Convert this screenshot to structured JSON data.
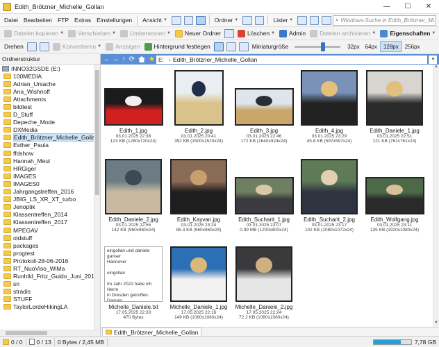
{
  "window": {
    "title": "Edith_Brötzner_Michelle_Gollan"
  },
  "menu": {
    "items": [
      "Datei",
      "Bearbeiten",
      "FTP",
      "Extras",
      "Einstellungen"
    ],
    "ansicht": "Ansicht",
    "ordner": "Ordner",
    "lister": "Lister",
    "search_placeholder": "Windows-Suche in Edith_Brötzner_Mi..."
  },
  "toolbar1": {
    "copy": "Dateien kopieren",
    "move": "Verschieben",
    "rename": "Umbenennen",
    "new_folder": "Neuer Ordner",
    "delete": "Löschen",
    "admin": "Admin",
    "archive": "Dateien archivieren",
    "properties": "Eigenschaften"
  },
  "toolbar2": {
    "rotate": "Drehen",
    "convert": "Konvertieren",
    "show": "Anzeigen",
    "set_background": "Hintergrund festlegen",
    "thumb_size_label": "Miniaturgröße",
    "sizes": [
      "32px",
      "64px",
      "128px",
      "256px"
    ],
    "active_size": "128px",
    "slider_fraction": 0.58
  },
  "tree": {
    "header": "Ordnerstruktur",
    "drive": "INNO32GSDE (E:)",
    "folders": [
      "100MEDIA",
      "Adrian_Ursache",
      "Ana_Wishnoff",
      "Attachments",
      "bildtest",
      "D_Stuff",
      "Depeche_Mode",
      "DXMedia",
      "Edith_Brötzner_Michelle_Gollan",
      "Esther_Paula",
      "ffdshow",
      "Hannah_Meul",
      "HRGiger",
      "IMAGES",
      "IMAGES0",
      "Jahrgangstreffen_2016",
      "JBIG_LS_XR_XT_turbo",
      "Jenoptik",
      "Klassentreffen_2014",
      "Klassentreffen_2017",
      "MPEGAV",
      "oldstuff",
      "packages",
      "progtest",
      "Protokoll-28-06-2016",
      "RT_NuoViso_WiMa",
      "Runhild_Fritz_Guido_Juni_2018",
      "sn",
      "stradis",
      "STUFF",
      "TaylorLordeHikingLA"
    ],
    "selected": "Edith_Brötzner_Michelle_Gollan"
  },
  "address": {
    "drive": "E:",
    "folder": "Edith_Brötzner_Michelle_Gollan"
  },
  "files": [
    {
      "name": "Edith_1.jpg",
      "date": "03.01.2025 22:38",
      "size": "123 KB (1280x720x24)",
      "shape": "land",
      "colors": [
        "#1b1b1b",
        "#d02020",
        "#f0f0f0"
      ]
    },
    {
      "name": "Edith_2.jpg",
      "date": "03.01.2025 20:41",
      "size": "352 KB (1500x1520x24)",
      "shape": "portrait",
      "colors": [
        "#e9eef2",
        "#d9c38a",
        "#1f2e4a"
      ]
    },
    {
      "name": "Edith_3.jpg",
      "date": "03.01.2025 22:46",
      "size": "172 KB (1640x924x24)",
      "shape": "land",
      "colors": [
        "#dfe5ec",
        "#caa66a",
        "#2a2e36"
      ]
    },
    {
      "name": "Edith_4.jpg",
      "date": "03.01.2025 23:29",
      "size": "45.8 KB (597x597x24)",
      "shape": "square",
      "colors": [
        "#7a92b8",
        "#222222",
        "#e4c07a"
      ]
    },
    {
      "name": "Edith_Daniele_1.jpg",
      "date": "03.01.2025 22:51",
      "size": "121 KB (761x761x24)",
      "shape": "square",
      "colors": [
        "#d8d5d0",
        "#2b2b2b",
        "#e0c07c"
      ]
    },
    {
      "name": "Edith_Daniele_2.jpg",
      "date": "03.01.2025 22:55",
      "size": "142 KB (960x960x24)",
      "shape": "square",
      "colors": [
        "#6d7b84",
        "#c9b8a2",
        "#3b4a55"
      ]
    },
    {
      "name": "Edith_Kayvan.jpg",
      "date": "03.01.2025 23:24",
      "size": "85.3 KB (960x960x24)",
      "shape": "square",
      "colors": [
        "#8a6b55",
        "#1e1e1e",
        "#c89e6e"
      ]
    },
    {
      "name": "Edith_Sucharit_1.jpg",
      "date": "03.01.2025 23:07",
      "size": "0.99 MB (1200x800x24)",
      "shape": "land",
      "colors": [
        "#6e7f62",
        "#3a3a40",
        "#d9c8a8"
      ]
    },
    {
      "name": "Edith_Sucharit_2.jpg",
      "date": "03.01.2025 23:17",
      "size": "102 KB (1080x1072x24)",
      "shape": "square",
      "colors": [
        "#5e7a56",
        "#2f3340",
        "#e2d0b0"
      ]
    },
    {
      "name": "Edith_Wolfgang.jpg",
      "date": "03.01.2025 23:11",
      "size": "135 KB (1920x1080x24)",
      "shape": "land",
      "colors": [
        "#4c6a48",
        "#2a2a2a",
        "#d8c09a"
      ]
    },
    {
      "name": "Michelle_Daniele.txt",
      "date": "17.05.2025 22:33",
      "size": "470 Bytes",
      "shape": "text",
      "preview": "eingollan und daniele ganser\nHannover\n\neingollan\n\nIm Jahr 2022 habe ich Herrn\nin Dresden getroffen. Damals\nihm führen. Heute, zweieinhalb\nzu interviewen. Ich bin b\neuer Feedback zu unsen"
    },
    {
      "name": "Michelle_Daniele_1.jpg",
      "date": "17.05.2025 22:16",
      "size": "149 KB (1080x1080x24)",
      "shape": "square",
      "colors": [
        "#2c6fb5",
        "#f2f2f2",
        "#d9b87a"
      ]
    },
    {
      "name": "Michelle_Daniele_2.jpg",
      "date": "17.05.2025 22:24",
      "size": "72.2 KB (1080x1080x24)",
      "shape": "square",
      "colors": [
        "#3a3a3c",
        "#e6e6e6",
        "#cfb080"
      ]
    }
  ],
  "tab": {
    "label": "Edith_Brötzner_Michelle_Gollan"
  },
  "status": {
    "folders": "0 / 0",
    "files": "0 / 13",
    "bytes": "0 Bytes / 2,45 MB",
    "disk": "7,78 GB",
    "disk_fraction": 0.72
  }
}
